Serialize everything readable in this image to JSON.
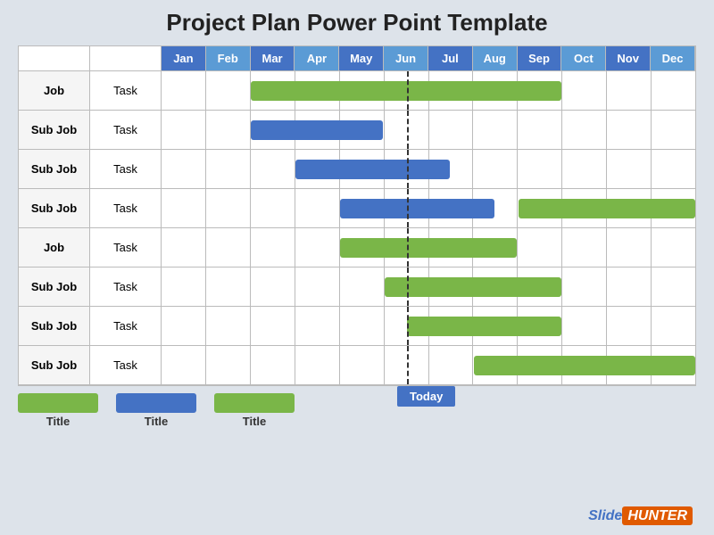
{
  "title": "Project Plan Power Point Template",
  "months": [
    "Jan",
    "Feb",
    "Mar",
    "Apr",
    "May",
    "Jun",
    "Jul",
    "Aug",
    "Sep",
    "Oct",
    "Nov",
    "Dec"
  ],
  "rows": [
    {
      "job": "Job",
      "task": "Task",
      "bar": {
        "color": "green",
        "start": 2,
        "span": 7
      }
    },
    {
      "job": "Sub Job",
      "task": "Task",
      "bar": {
        "color": "blue",
        "start": 2,
        "span": 3
      }
    },
    {
      "job": "Sub Job",
      "task": "Task",
      "bar": {
        "color": "blue",
        "start": 3,
        "span": 3.5
      }
    },
    {
      "job": "Sub Job",
      "task": "Task",
      "bar": {
        "color": "blue",
        "start": 4,
        "span": 3.5
      },
      "bar2": {
        "color": "green",
        "start": 8,
        "span": 4
      }
    },
    {
      "job": "Job",
      "task": "Task",
      "bar": {
        "color": "green",
        "start": 4,
        "span": 4
      }
    },
    {
      "job": "Sub Job",
      "task": "Task",
      "bar": {
        "color": "green",
        "start": 5,
        "span": 4
      }
    },
    {
      "job": "Sub Job",
      "task": "Task",
      "bar": {
        "color": "green",
        "start": 5.5,
        "span": 3.5
      }
    },
    {
      "job": "Sub Job",
      "task": "Task",
      "bar": {
        "color": "green",
        "start": 7,
        "span": 5
      }
    }
  ],
  "today_col": 5.5,
  "today_label": "Today",
  "legend": [
    {
      "color": "green",
      "label": "Title"
    },
    {
      "color": "blue",
      "label": "Title"
    },
    {
      "color": "green",
      "label": "Title"
    }
  ],
  "logo": {
    "slide": "Slide",
    "hunter": "HUNTER"
  }
}
